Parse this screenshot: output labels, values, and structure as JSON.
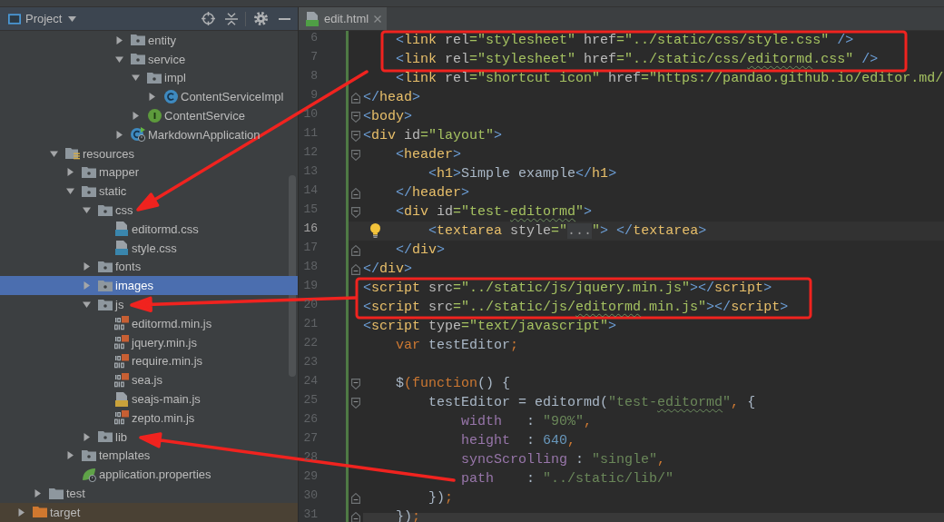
{
  "project_panel": {
    "title": "Project",
    "tree": [
      {
        "children": [
          {
            "children": [
              {
                "children": [
                  {
                    "children": [
                      {
                        "children": [
                          {
                            "children": [
                              {
                                "label": "entity",
                                "kind": "package",
                                "expanded": false,
                                "selected": false
                              },
                              {
                                "label": "service",
                                "kind": "package",
                                "expanded": true,
                                "selected": false,
                                "children": [
                                  {
                                    "label": "impl",
                                    "kind": "package",
                                    "expanded": true,
                                    "selected": false,
                                    "children": [
                                      {
                                        "label": "ContentServiceImpl",
                                        "kind": "class",
                                        "expanded": false,
                                        "selected": false
                                      }
                                    ]
                                  },
                                  {
                                    "label": "ContentService",
                                    "kind": "interface",
                                    "expanded": false,
                                    "selected": false
                                  }
                                ]
                              },
                              {
                                "label": "MarkdownApplication",
                                "kind": "boot-class",
                                "expanded": false,
                                "selected": false
                              }
                            ]
                          }
                        ]
                      }
                    ]
                  }
                ]
              },
              {
                "label": "resources",
                "kind": "resources-folder",
                "expanded": true,
                "selected": false,
                "children": [
                  {
                    "label": "mapper",
                    "kind": "package",
                    "expanded": false,
                    "selected": false
                  },
                  {
                    "label": "static",
                    "kind": "package",
                    "expanded": true,
                    "selected": false,
                    "children": [
                      {
                        "label": "css",
                        "kind": "package",
                        "expanded": true,
                        "selected": false,
                        "children": [
                          {
                            "label": "editormd.css",
                            "kind": "css-file",
                            "selected": false
                          },
                          {
                            "label": "style.css",
                            "kind": "css-file",
                            "selected": false
                          }
                        ]
                      },
                      {
                        "label": "fonts",
                        "kind": "package",
                        "expanded": false,
                        "selected": false
                      },
                      {
                        "label": "images",
                        "kind": "package",
                        "expanded": false,
                        "selected": true
                      },
                      {
                        "label": "js",
                        "kind": "package",
                        "expanded": true,
                        "selected": false,
                        "children": [
                          {
                            "label": "editormd.min.js",
                            "kind": "js-min-file",
                            "selected": false
                          },
                          {
                            "label": "jquery.min.js",
                            "kind": "js-min-file",
                            "selected": false
                          },
                          {
                            "label": "require.min.js",
                            "kind": "js-min-file",
                            "selected": false
                          },
                          {
                            "label": "sea.js",
                            "kind": "js-min-file",
                            "selected": false
                          },
                          {
                            "label": "seajs-main.js",
                            "kind": "js-file",
                            "selected": false
                          },
                          {
                            "label": "zepto.min.js",
                            "kind": "js-min-file",
                            "selected": false
                          }
                        ]
                      },
                      {
                        "label": "lib",
                        "kind": "package",
                        "expanded": false,
                        "selected": false
                      }
                    ]
                  },
                  {
                    "label": "templates",
                    "kind": "package",
                    "expanded": false,
                    "selected": false
                  },
                  {
                    "label": "application.properties",
                    "kind": "properties-file",
                    "selected": false
                  }
                ]
              }
            ]
          },
          {
            "label": "test",
            "kind": "folder",
            "expanded": false,
            "selected": false
          }
        ]
      },
      {
        "label": "target",
        "kind": "excluded-folder",
        "expanded": false,
        "selected": false
      }
    ]
  },
  "editor": {
    "tabs": [
      {
        "label": "edit.html",
        "selected": true
      }
    ],
    "lines": [
      {
        "number": "6",
        "current": false,
        "bulb": false,
        "tokens": [
          {
            "kind": "bracket",
            "text": "    <"
          },
          {
            "kind": "tag",
            "text": "link"
          },
          {
            "kind": "attr",
            "text": " rel"
          },
          {
            "kind": "value",
            "text": "=\"stylesheet\""
          },
          {
            "kind": "attr",
            "text": " href"
          },
          {
            "kind": "value",
            "text": "=\"../static/css/style.css\""
          },
          {
            "kind": "bracket",
            "text": " />"
          }
        ]
      },
      {
        "number": "7",
        "current": false,
        "bulb": false,
        "tokens": [
          {
            "kind": "bracket",
            "text": "    <"
          },
          {
            "kind": "tag",
            "text": "link"
          },
          {
            "kind": "attr",
            "text": " rel"
          },
          {
            "kind": "value",
            "text": "=\"stylesheet\""
          },
          {
            "kind": "attr",
            "text": " href"
          },
          {
            "kind": "value",
            "text": "=\"../static/css/"
          },
          {
            "kind": "value-typo",
            "text": "editormd"
          },
          {
            "kind": "value",
            "text": ".css\""
          },
          {
            "kind": "bracket",
            "text": " />"
          }
        ]
      },
      {
        "number": "8",
        "current": false,
        "bulb": false,
        "tokens": [
          {
            "kind": "bracket",
            "text": "    <"
          },
          {
            "kind": "tag",
            "text": "link"
          },
          {
            "kind": "attr",
            "text": " rel"
          },
          {
            "kind": "value",
            "text": "=\"shortcut icon\""
          },
          {
            "kind": "attr",
            "text": " href"
          },
          {
            "kind": "value",
            "text": "=\"https://pandao.github.io/editor.md/"
          }
        ]
      },
      {
        "number": "9",
        "current": false,
        "bulb": false,
        "fold": {
          "kind": "end"
        },
        "tokens": [
          {
            "kind": "bracket",
            "text": "</"
          },
          {
            "kind": "tag",
            "text": "head"
          },
          {
            "kind": "bracket",
            "text": ">"
          }
        ]
      },
      {
        "number": "10",
        "current": false,
        "bulb": false,
        "fold": {
          "kind": "start"
        },
        "tokens": [
          {
            "kind": "bracket",
            "text": "<"
          },
          {
            "kind": "tag",
            "text": "body"
          },
          {
            "kind": "bracket",
            "text": ">"
          }
        ]
      },
      {
        "number": "11",
        "current": false,
        "bulb": false,
        "fold": {
          "kind": "start"
        },
        "tokens": [
          {
            "kind": "bracket",
            "text": "<"
          },
          {
            "kind": "tag",
            "text": "div"
          },
          {
            "kind": "attr",
            "text": " id"
          },
          {
            "kind": "value",
            "text": "=\"layout\""
          },
          {
            "kind": "bracket",
            "text": ">"
          }
        ]
      },
      {
        "number": "12",
        "current": false,
        "bulb": false,
        "fold": {
          "kind": "start"
        },
        "tokens": [
          {
            "kind": "bracket",
            "text": "    <"
          },
          {
            "kind": "tag",
            "text": "header"
          },
          {
            "kind": "bracket",
            "text": ">"
          }
        ]
      },
      {
        "number": "13",
        "current": false,
        "bulb": false,
        "tokens": [
          {
            "kind": "bracket",
            "text": "        <"
          },
          {
            "kind": "tag",
            "text": "h1"
          },
          {
            "kind": "bracket",
            "text": ">"
          },
          {
            "kind": "text",
            "text": "Simple example"
          },
          {
            "kind": "bracket",
            "text": "</"
          },
          {
            "kind": "tag",
            "text": "h1"
          },
          {
            "kind": "bracket",
            "text": ">"
          }
        ]
      },
      {
        "number": "14",
        "current": false,
        "bulb": false,
        "fold": {
          "kind": "end"
        },
        "tokens": [
          {
            "kind": "bracket",
            "text": "    </"
          },
          {
            "kind": "tag",
            "text": "header"
          },
          {
            "kind": "bracket",
            "text": ">"
          }
        ]
      },
      {
        "number": "15",
        "current": false,
        "bulb": false,
        "fold": {
          "kind": "start"
        },
        "tokens": [
          {
            "kind": "bracket",
            "text": "    <"
          },
          {
            "kind": "tag",
            "text": "div"
          },
          {
            "kind": "attr",
            "text": " id"
          },
          {
            "kind": "value",
            "text": "=\"test-"
          },
          {
            "kind": "value-typo",
            "text": "editormd"
          },
          {
            "kind": "value",
            "text": "\""
          },
          {
            "kind": "bracket",
            "text": ">"
          }
        ]
      },
      {
        "number": "16",
        "current": true,
        "bulb": true,
        "tokens": [
          {
            "kind": "bracket",
            "text": "        <"
          },
          {
            "kind": "tag",
            "text": "textarea"
          },
          {
            "kind": "attr",
            "text": " style"
          },
          {
            "kind": "value",
            "text": "=\""
          },
          {
            "kind": "fold",
            "text": "..."
          },
          {
            "kind": "value",
            "text": "\""
          },
          {
            "kind": "bracket",
            "text": "> </"
          },
          {
            "kind": "tag",
            "text": "textarea"
          },
          {
            "kind": "bracket",
            "text": ">"
          }
        ]
      },
      {
        "number": "17",
        "current": false,
        "bulb": false,
        "fold": {
          "kind": "end"
        },
        "tokens": [
          {
            "kind": "bracket",
            "text": "    </"
          },
          {
            "kind": "tag",
            "text": "div"
          },
          {
            "kind": "bracket",
            "text": ">"
          }
        ]
      },
      {
        "number": "18",
        "current": false,
        "bulb": false,
        "fold": {
          "kind": "end"
        },
        "tokens": [
          {
            "kind": "bracket",
            "text": "</"
          },
          {
            "kind": "tag",
            "text": "div"
          },
          {
            "kind": "bracket",
            "text": ">"
          }
        ]
      },
      {
        "number": "19",
        "current": false,
        "bulb": false,
        "tokens": [
          {
            "kind": "bracket",
            "text": "<"
          },
          {
            "kind": "tag",
            "text": "script"
          },
          {
            "kind": "attr",
            "text": " src"
          },
          {
            "kind": "value",
            "text": "=\"../static/js/jquery.min.js\""
          },
          {
            "kind": "bracket",
            "text": "></"
          },
          {
            "kind": "tag",
            "text": "script"
          },
          {
            "kind": "bracket",
            "text": ">"
          }
        ]
      },
      {
        "number": "20",
        "current": false,
        "bulb": false,
        "tokens": [
          {
            "kind": "bracket",
            "text": "<"
          },
          {
            "kind": "tag",
            "text": "script"
          },
          {
            "kind": "attr",
            "text": " src"
          },
          {
            "kind": "value",
            "text": "=\"../static/js/"
          },
          {
            "kind": "value-typo",
            "text": "editormd"
          },
          {
            "kind": "value",
            "text": ".min.js\""
          },
          {
            "kind": "bracket",
            "text": "></"
          },
          {
            "kind": "tag",
            "text": "script"
          },
          {
            "kind": "bracket",
            "text": ">"
          }
        ]
      },
      {
        "number": "21",
        "current": false,
        "bulb": false,
        "tokens": [
          {
            "kind": "bracket",
            "text": "<"
          },
          {
            "kind": "tag",
            "text": "script"
          },
          {
            "kind": "attr",
            "text": " type"
          },
          {
            "kind": "value",
            "text": "=\"text/javascript\""
          },
          {
            "kind": "bracket",
            "text": ">"
          }
        ]
      },
      {
        "number": "22",
        "current": false,
        "bulb": false,
        "tokens": [
          {
            "kind": "keyword",
            "text": "    var"
          },
          {
            "kind": "plain",
            "text": " testEditor"
          },
          {
            "kind": "punct",
            "text": ";"
          }
        ]
      },
      {
        "number": "23",
        "current": false,
        "bulb": false
      },
      {
        "number": "24",
        "current": false,
        "bulb": false,
        "fold": {
          "kind": "start"
        },
        "tokens": [
          {
            "kind": "plain",
            "text": "    $"
          },
          {
            "kind": "keyword",
            "text": "(function"
          },
          {
            "kind": "plain",
            "text": "() {"
          }
        ]
      },
      {
        "number": "25",
        "current": false,
        "bulb": false,
        "fold": {
          "kind": "start"
        },
        "tokens": [
          {
            "kind": "plain",
            "text": "        testEditor = editormd("
          },
          {
            "kind": "string",
            "text": "\"test-"
          },
          {
            "kind": "string-typo",
            "text": "editormd"
          },
          {
            "kind": "string",
            "text": "\""
          },
          {
            "kind": "punct",
            "text": ","
          },
          {
            "kind": "plain",
            "text": " {"
          }
        ]
      },
      {
        "number": "26",
        "current": false,
        "bulb": false,
        "tokens": [
          {
            "kind": "property",
            "text": "            width"
          },
          {
            "kind": "plain",
            "text": "   : "
          },
          {
            "kind": "string",
            "text": "\"90%\""
          },
          {
            "kind": "punct",
            "text": ","
          }
        ]
      },
      {
        "number": "27",
        "current": false,
        "bulb": false,
        "tokens": [
          {
            "kind": "property",
            "text": "            height"
          },
          {
            "kind": "plain",
            "text": "  : "
          },
          {
            "kind": "number",
            "text": "640"
          },
          {
            "kind": "punct",
            "text": ","
          }
        ]
      },
      {
        "number": "28",
        "current": false,
        "bulb": false,
        "tokens": [
          {
            "kind": "property",
            "text": "            syncScrolling"
          },
          {
            "kind": "plain",
            "text": " : "
          },
          {
            "kind": "string",
            "text": "\"single\""
          },
          {
            "kind": "punct",
            "text": ","
          }
        ]
      },
      {
        "number": "29",
        "current": false,
        "bulb": false,
        "tokens": [
          {
            "kind": "property",
            "text": "            path"
          },
          {
            "kind": "plain",
            "text": "    : "
          },
          {
            "kind": "string",
            "text": "\"../static/lib/\""
          }
        ]
      },
      {
        "number": "30",
        "current": false,
        "bulb": false,
        "fold": {
          "kind": "end"
        },
        "tokens": [
          {
            "kind": "plain",
            "text": "        })"
          },
          {
            "kind": "punct",
            "text": ";"
          }
        ]
      },
      {
        "number": "31",
        "current": false,
        "bulb": false,
        "fold": {
          "kind": "end"
        },
        "tokens": [
          {
            "kind": "plain",
            "text": "    })"
          },
          {
            "kind": "punct",
            "text": ";"
          }
        ]
      }
    ]
  }
}
